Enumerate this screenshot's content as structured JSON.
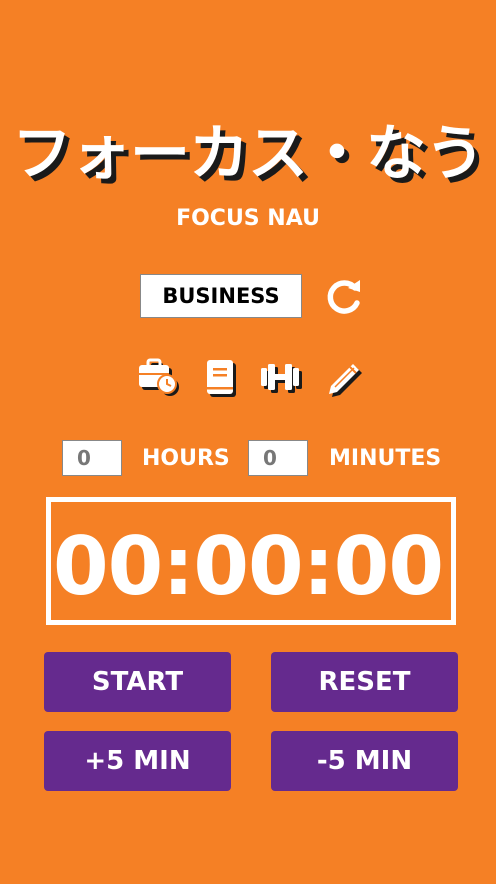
{
  "app": {
    "title_jp": "フォーカス・なう",
    "title_en": "FOCUS NAU"
  },
  "category": {
    "selected": "BUSINESS",
    "icons": [
      "briefcase-clock-icon",
      "book-icon",
      "dumbbell-icon",
      "pencil-icon"
    ]
  },
  "time_input": {
    "hours_value": "0",
    "hours_label": "HOURS",
    "minutes_value": "0",
    "minutes_label": "MINUTES"
  },
  "timer": {
    "display": "00:00:00"
  },
  "buttons": {
    "start": "START",
    "reset": "RESET",
    "plus5": "+5 MIN",
    "minus5": "-5 MIN"
  },
  "colors": {
    "background": "#F58025",
    "button": "#652A8E",
    "text": "#FFFFFF"
  }
}
